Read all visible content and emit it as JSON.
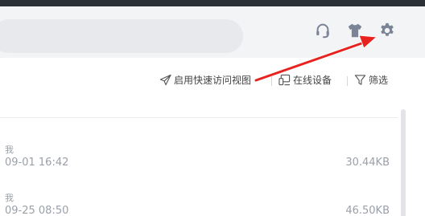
{
  "header": {
    "icons": [
      "headset-icon",
      "tshirt-icon",
      "gear-icon"
    ],
    "accent_icon_color": "#7b8496"
  },
  "toolbar": {
    "quick_access": "启用快速访问视图",
    "online_devices": "在线设备",
    "filter": "筛选"
  },
  "files": [
    {
      "sender": "我",
      "time": "09-01 16:42",
      "size": "30.44KB"
    },
    {
      "sender": "我",
      "time": "09-25 08:50",
      "size": "46.50KB"
    }
  ],
  "annotation": {
    "arrow_color": "#e8231f"
  }
}
